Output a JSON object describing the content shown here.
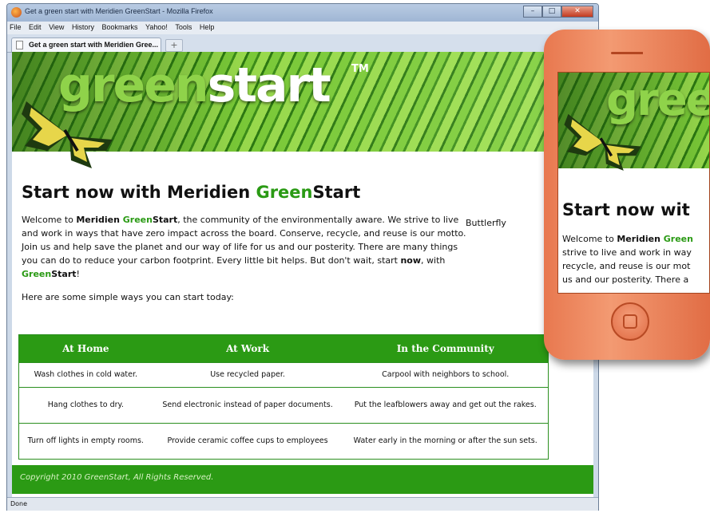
{
  "window": {
    "title": "Get a green start with Meridien GreenStart - Mozilla Firefox",
    "min": "–",
    "max": "□",
    "close": "✕"
  },
  "menu": [
    "File",
    "Edit",
    "View",
    "History",
    "Bookmarks",
    "Yahoo!",
    "Tools",
    "Help"
  ],
  "tab": {
    "label": "Get a green start with Meridien Gree...",
    "new_tab": "+"
  },
  "status": "Done",
  "logo": {
    "green": "green",
    "start": "start",
    "tm": "TM"
  },
  "heading": {
    "part1": "Start now with Meridien ",
    "green": "Green",
    "part2": "Start"
  },
  "intro": {
    "t1": "Welcome to ",
    "meridien": "Meridien ",
    "green": "Green",
    "start": "Start",
    "t2": ", the community of the environmentally aware. We strive to live and work in ways that have zero impact across the board. Conserve, recycle, and reuse is our motto. Join us and help save the planet and our way of life for us and our posterity. There are many things you can do to reduce your carbon footprint. Every little bit helps. But don't wait, start ",
    "now": "now",
    "t3": ", with ",
    "end": "!"
  },
  "caption": "Buttlerfly",
  "ways": "Here are some simple ways you can start today:",
  "table": {
    "headers": [
      "At Home",
      "At Work",
      "In the Community"
    ],
    "rows": [
      [
        "Wash clothes in cold water.",
        "Use recycled paper.",
        "Carpool with neighbors to school."
      ],
      [
        "Hang clothes to dry.",
        "Send electronic instead of paper documents.",
        "Put the leafblowers away and get out the rakes."
      ],
      [
        "Turn off lights in empty rooms.",
        "Provide ceramic coffee cups to employees",
        "Water early in the morning or after the sun sets."
      ]
    ]
  },
  "footer": "Copyright 2010 GreenStart, All Rights Reserved.",
  "phone": {
    "logo": "gree",
    "heading": "Start now wit",
    "lines": {
      "l1a": "Welcome to ",
      "l1b": "Meridien ",
      "l1c": "Green",
      "l2": "strive to live and work in way",
      "l3": "recycle, and reuse is our mot",
      "l4": "us and our posterity. There a"
    }
  },
  "colors": {
    "brand_green": "#2b9a14",
    "phone_orange": "#e8784f"
  }
}
